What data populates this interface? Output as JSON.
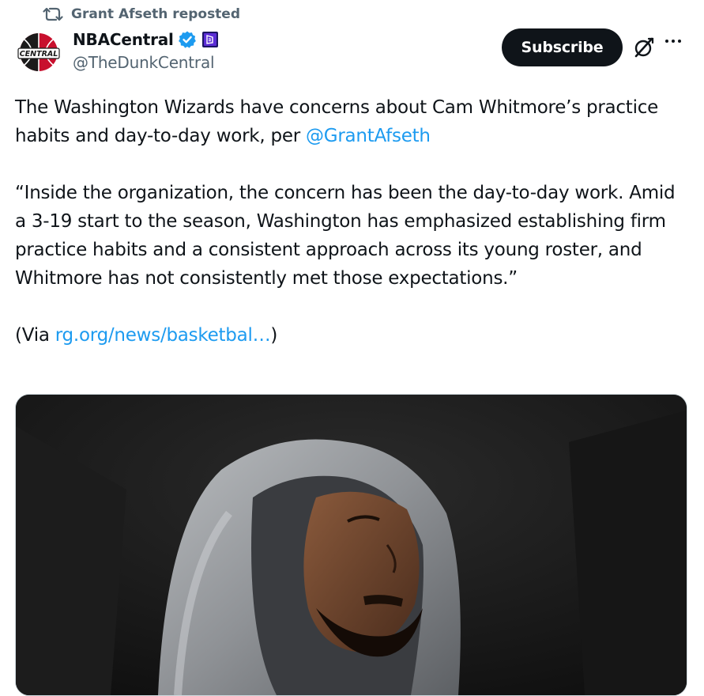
{
  "repost": {
    "icon": "repost-icon",
    "text": "Grant Afseth reposted"
  },
  "author": {
    "avatar_icon": "nba-central-logo",
    "avatar_text": "CENTRAL",
    "display_name": "NBACentral",
    "verified_icon": "verified-badge-icon",
    "affiliate_icon": "affiliate-badge-icon",
    "handle": "@TheDunkCentral"
  },
  "actions": {
    "subscribe_label": "Subscribe",
    "grok_icon": "grok-icon",
    "more_icon": "more-icon"
  },
  "tweet": {
    "para1_text": "The Washington Wizards have concerns about Cam Whitmore’s practice habits and day-to-day work, per ",
    "para1_mention": "@GrantAfseth",
    "para2_text": "“Inside the organization, the concern has been the day-to-day work. Amid a 3-19 start to the season, Washington has emphasized establishing firm practice habits and a consistent approach across its young roster, and Whitmore has not consistently met those expectations.”",
    "para3_prefix": "(Via ",
    "para3_link": "rg.org/news/basketbal…",
    "para3_suffix": ")"
  },
  "media": {
    "description_icon": "player-photo"
  },
  "colors": {
    "accent": "#1d9bf0",
    "text": "#0f1419",
    "secondary": "#536471",
    "verified": "#1d9bf0",
    "affiliate": "#5b2dd6"
  }
}
